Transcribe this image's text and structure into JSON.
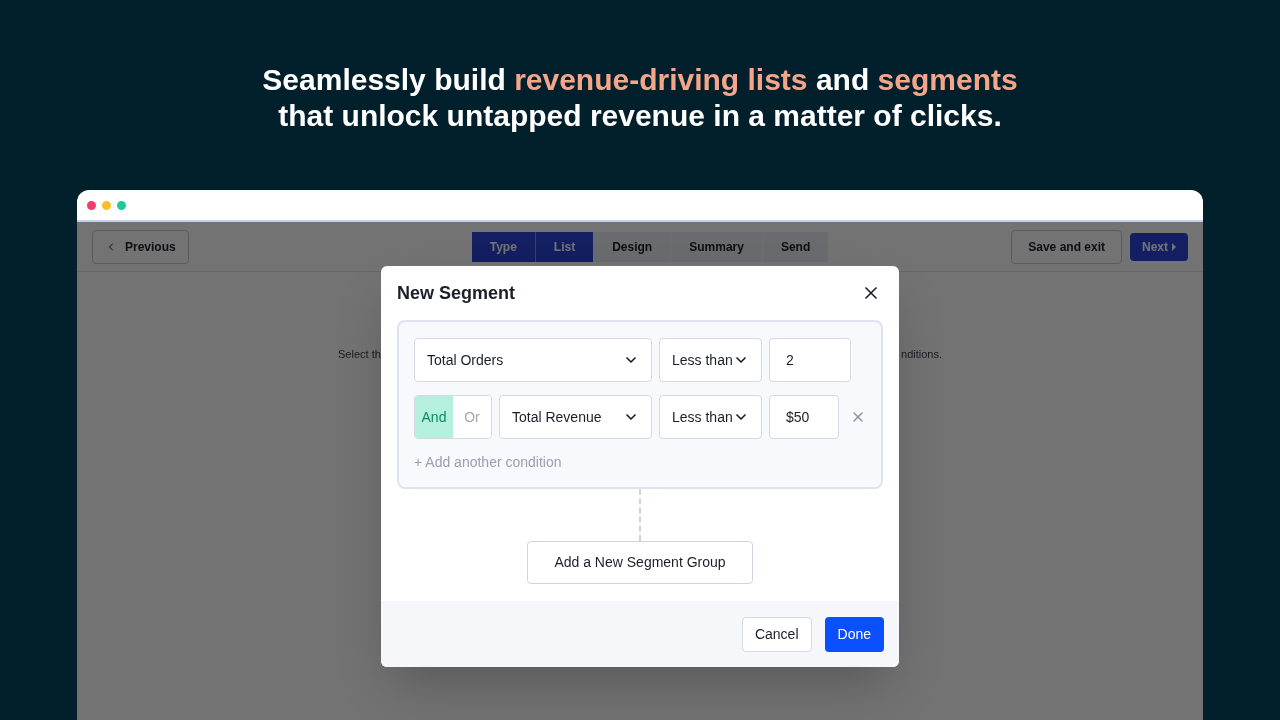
{
  "headline": {
    "lines": [
      [
        {
          "text": "Seamlessly build ",
          "highlight": false
        },
        {
          "text": "revenue-driving lists",
          "highlight": true
        },
        {
          "text": " and ",
          "highlight": false
        },
        {
          "text": "segments",
          "highlight": true
        }
      ],
      [
        {
          "text": "that unlock untapped revenue in a matter of clicks.",
          "highlight": false
        }
      ]
    ]
  },
  "app": {
    "previous_button": "Previous",
    "steps": [
      {
        "label": "Type",
        "done": true
      },
      {
        "label": "List",
        "done": true
      },
      {
        "label": "Design",
        "done": false
      },
      {
        "label": "Summary",
        "done": false
      },
      {
        "label": "Send",
        "done": false
      }
    ],
    "save_button": "Save and exit",
    "next_button": "Next",
    "background_hint": {
      "left": "Select th",
      "right": "nditions."
    }
  },
  "modal": {
    "title": "New Segment",
    "conditions": [
      {
        "field": "Total Orders",
        "operator": "Less than",
        "value": "2",
        "removable": false
      },
      {
        "connectors": [
          {
            "label": "And",
            "selected": true
          },
          {
            "label": "Or",
            "selected": false
          }
        ],
        "field": "Total Revenue",
        "operator": "Less than",
        "value": "$50",
        "removable": true
      }
    ],
    "add_condition": "+ Add another condition",
    "add_group": "Add a New Segment Group",
    "cancel": "Cancel",
    "done": "Done"
  }
}
